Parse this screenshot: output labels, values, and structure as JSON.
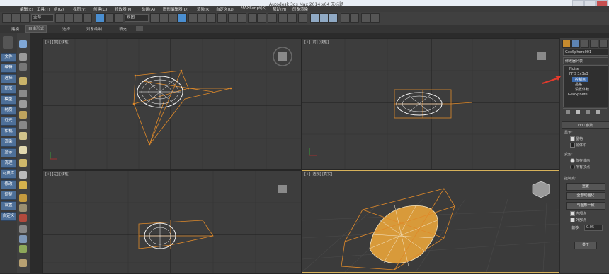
{
  "titlebar": {
    "title": "Autodesk 3ds Max  2014 x64     无标题"
  },
  "menu": [
    "编辑(E)",
    "工具(T)",
    "组(G)",
    "视图(V)",
    "创建(C)",
    "修改器(M)",
    "动画(A)",
    "图形编辑器(D)",
    "渲染(R)",
    "自定义(U)",
    "MAXScript(X)",
    "帮助(H)",
    "印象渲染"
  ],
  "toolbar": {
    "selection_filter": "全部",
    "ref_coord": "视图"
  },
  "ribbon": {
    "tabs": [
      "建模",
      "自由形式",
      "选择",
      "对象绘制",
      "填充"
    ],
    "active_index": 1
  },
  "left_buttons": [
    "文件",
    "编辑",
    "选择",
    "图形",
    "模型",
    "材质",
    "灯光",
    "相机",
    "渲染",
    "显示",
    "清理",
    "材质库",
    "修改",
    "调整",
    "设置",
    "自定义"
  ],
  "viewports": {
    "top": "[+] [顶] [线框]",
    "front": "[+] [前] [线框]",
    "left": "[+] [左] [线框]",
    "perspective": "[+] [透视] [真实]"
  },
  "command_panel": {
    "object_name": "GeoSphere001",
    "modifier_list_label": "修改器列表",
    "stack": [
      "Noise",
      "FFD 3x3x3",
      "控制点",
      "晶格",
      "设置体积",
      "GeoSphere"
    ],
    "stack_selected": 2,
    "rollout_title": "FFD 参数",
    "display_label": "显示:",
    "lattice_label": "晶格",
    "source_volume_label": "源体积",
    "deform_label": "变形:",
    "only_in_volume": "仅在体内",
    "all_vertices": "所有顶点",
    "control_points_label": "控制点:",
    "reset_button": "重置",
    "animate_all_button": "全部动画化",
    "conform_button": "与图形一致",
    "inside_points": "内部点",
    "outside_points": "外部点",
    "offset_label": "偏移:",
    "offset_value": "0.05",
    "about_button": "关于"
  }
}
